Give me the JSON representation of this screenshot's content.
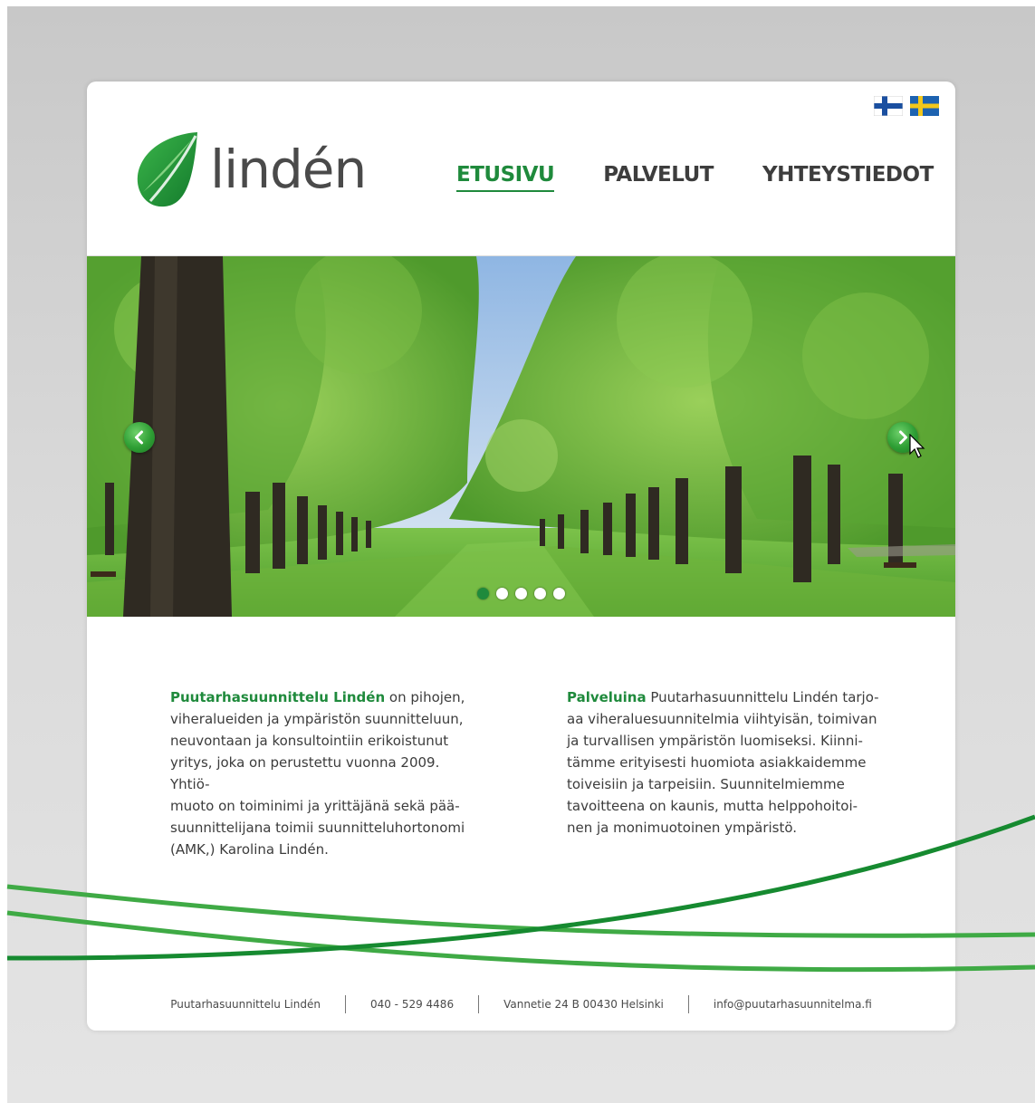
{
  "brand": {
    "name": "lindén"
  },
  "languages": [
    {
      "name": "Suomi",
      "icon": "finland-flag-icon"
    },
    {
      "name": "Svenska",
      "icon": "sweden-flag-icon"
    }
  ],
  "nav": {
    "items": [
      {
        "label": "ETUSIVU",
        "active": true
      },
      {
        "label": "PALVELUT",
        "active": false
      },
      {
        "label": "YHTEYSTIEDOT",
        "active": false
      }
    ]
  },
  "slider": {
    "prev_icon": "chevron-left-icon",
    "next_icon": "chevron-right-icon",
    "slide_count": 5,
    "active_slide": 1
  },
  "intro": {
    "left": {
      "highlight": "Puutarhasuunnittelu Lindén",
      "lines": [
        " on pihojen,",
        "viheralueiden ja ympäristön suunnitteluun,",
        "neuvontaan ja konsultointiin erikoistunut",
        "yritys, joka on perustettu vuonna 2009. Yhtiö-",
        "muoto on toiminimi ja yrittäjänä sekä pää-",
        "suunnittelijana toimii suunnitteluhortonomi",
        "(AMK,) Karolina Lindén."
      ]
    },
    "right": {
      "highlight": "Palveluina",
      "lines": [
        " Puutarhasuunnittelu Lindén tarjo-",
        "aa viheraluesuunnitelmia viihtyisän, toimivan",
        "ja turvallisen ympäristön luomiseksi. Kiinni-",
        "tämme erityisesti huomiota asiakkaidemme",
        "toiveisiin ja tarpeisiin. Suunnitelmiemme",
        "tavoitteena on kaunis, mutta helppohoitoi-",
        "nen ja monimuotoinen ympäristö."
      ]
    }
  },
  "footer": {
    "company": "Puutarhasuunnittelu Lindén",
    "phone": "040 - 529 4486",
    "address": "Vannetie 24 B 00430 Helsinki",
    "email": "info@puutarhasuunnitelma.fi"
  },
  "colors": {
    "accent": "#1f8a3c",
    "text": "#3c3c3c",
    "swoosh_light": "#3faa45",
    "swoosh_dark": "#168a30"
  }
}
